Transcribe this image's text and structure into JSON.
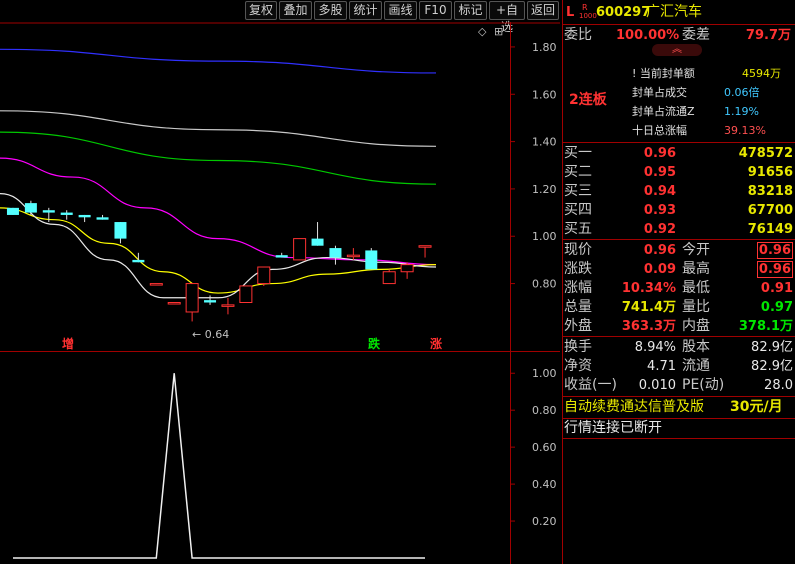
{
  "toolbar": {
    "buttons": [
      "复权",
      "叠加",
      "多股",
      "统计",
      "画线",
      "F10",
      "标记",
      "+自选",
      "返回"
    ]
  },
  "header": {
    "market_flag": "L",
    "badge_top": "R",
    "badge_bottom": "1000",
    "code": "600297",
    "name": "广汇汽车"
  },
  "ratio": {
    "wb_label": "委比",
    "wb_value": "100.00%",
    "wc_label": "委差",
    "wc_value": "79.7万"
  },
  "limit_up": {
    "badge": "2连板",
    "lines": [
      {
        "label": "当前封单额",
        "value": "4594万",
        "color": "#e8e800"
      },
      {
        "label": "封单占成交",
        "value": "0.06倍",
        "color": "#40c8ff"
      },
      {
        "label": "封单占流通Z",
        "value": "1.19%",
        "color": "#40c8ff"
      },
      {
        "label": "十日总涨幅",
        "value": "39.13%",
        "color": "#ff5050"
      }
    ]
  },
  "bids": [
    {
      "label": "买一",
      "price": "0.96",
      "volume": "478572"
    },
    {
      "label": "买二",
      "price": "0.95",
      "volume": "91656"
    },
    {
      "label": "买三",
      "price": "0.94",
      "volume": "83218"
    },
    {
      "label": "买四",
      "price": "0.93",
      "volume": "67700"
    },
    {
      "label": "买五",
      "price": "0.92",
      "volume": "76149"
    }
  ],
  "quote": [
    {
      "l1": "现价",
      "v1": "0.96",
      "c1": "red",
      "l2": "今开",
      "v2": "0.96",
      "c2": "red",
      "box2": true
    },
    {
      "l1": "涨跌",
      "v1": "0.09",
      "c1": "red",
      "l2": "最高",
      "v2": "0.96",
      "c2": "red",
      "box2": true
    },
    {
      "l1": "涨幅",
      "v1": "10.34%",
      "c1": "red",
      "l2": "最低",
      "v2": "0.91",
      "c2": "red",
      "box2": false
    },
    {
      "l1": "总量",
      "v1": "741.4万",
      "c1": "yel",
      "l2": "量比",
      "v2": "0.97",
      "c2": "grn",
      "box2": false
    },
    {
      "l1": "外盘",
      "v1": "363.3万",
      "c1": "red",
      "l2": "内盘",
      "v2": "378.1万",
      "c2": "grn",
      "box2": false
    }
  ],
  "fundamentals": [
    {
      "l1": "换手",
      "v1": "8.94%",
      "l2": "股本",
      "v2": "82.9亿"
    },
    {
      "l1": "净资",
      "v1": "4.71",
      "l2": "流通",
      "v2": "82.9亿"
    },
    {
      "l1": "收益(一)",
      "v1": "0.010",
      "l2": "PE(动)",
      "v2": "28.0"
    }
  ],
  "promo": {
    "text": "自动续费通达信普及版",
    "price": "30元/月"
  },
  "status": "行情连接已断开",
  "chart_data": {
    "type": "candlestick",
    "y_ticks": [
      "1.80",
      "1.60",
      "1.40",
      "1.20",
      "1.00",
      "0.80"
    ],
    "ylim": [
      0.57,
      1.88
    ],
    "annotation_low": "0.64",
    "markers": [
      {
        "text": "增",
        "color": "#ff3030"
      },
      {
        "text": "跌",
        "color": "#00e600"
      },
      {
        "text": "涨",
        "color": "#ff3030"
      }
    ],
    "candles": [
      {
        "open": 1.12,
        "close": 1.09,
        "high": 1.12,
        "low": 1.09
      },
      {
        "open": 1.14,
        "close": 1.1,
        "high": 1.15,
        "low": 1.09
      },
      {
        "open": 1.11,
        "close": 1.1,
        "high": 1.12,
        "low": 1.06
      },
      {
        "open": 1.1,
        "close": 1.09,
        "high": 1.11,
        "low": 1.07
      },
      {
        "open": 1.09,
        "close": 1.08,
        "high": 1.09,
        "low": 1.06
      },
      {
        "open": 1.08,
        "close": 1.07,
        "high": 1.09,
        "low": 1.07
      },
      {
        "open": 1.06,
        "close": 0.99,
        "high": 1.06,
        "low": 0.97
      },
      {
        "open": 0.9,
        "close": 0.89,
        "high": 0.93,
        "low": 0.89
      },
      {
        "open": 0.8,
        "close": 0.8,
        "high": 0.8,
        "low": 0.8
      },
      {
        "open": 0.72,
        "close": 0.72,
        "high": 0.72,
        "low": 0.72
      },
      {
        "open": 0.68,
        "close": 0.8,
        "high": 0.8,
        "low": 0.64
      },
      {
        "open": 0.73,
        "close": 0.72,
        "high": 0.75,
        "low": 0.71
      },
      {
        "open": 0.71,
        "close": 0.71,
        "high": 0.74,
        "low": 0.67
      },
      {
        "open": 0.72,
        "close": 0.79,
        "high": 0.79,
        "low": 0.72
      },
      {
        "open": 0.8,
        "close": 0.87,
        "high": 0.87,
        "low": 0.79
      },
      {
        "open": 0.92,
        "close": 0.91,
        "high": 0.93,
        "low": 0.91
      },
      {
        "open": 0.9,
        "close": 0.99,
        "high": 0.99,
        "low": 0.9
      },
      {
        "open": 0.99,
        "close": 0.96,
        "high": 1.06,
        "low": 0.96
      },
      {
        "open": 0.95,
        "close": 0.91,
        "high": 0.96,
        "low": 0.88
      },
      {
        "open": 0.92,
        "close": 0.92,
        "high": 0.95,
        "low": 0.9
      },
      {
        "open": 0.94,
        "close": 0.86,
        "high": 0.95,
        "low": 0.86
      },
      {
        "open": 0.8,
        "close": 0.85,
        "high": 0.86,
        "low": 0.8
      },
      {
        "open": 0.85,
        "close": 0.88,
        "high": 0.89,
        "low": 0.82
      },
      {
        "open": 0.96,
        "close": 0.96,
        "high": 0.96,
        "low": 0.91
      }
    ],
    "ma_lines": [
      {
        "color": "#3030ff",
        "points": [
          1.79,
          1.74,
          1.69
        ]
      },
      {
        "color": "#c8c8c8",
        "points": [
          1.53,
          1.45,
          1.38
        ]
      },
      {
        "color": "#00c800",
        "points": [
          1.44,
          1.32,
          1.22
        ]
      },
      {
        "color": "#ff00ff",
        "points": [
          1.33,
          1.25,
          1.12,
          0.99,
          0.91,
          0.9,
          0.88
        ]
      },
      {
        "color": "#ffff00",
        "points": [
          1.12,
          1.07,
          0.97,
          0.85,
          0.76,
          0.8,
          0.84,
          0.86,
          0.88
        ]
      },
      {
        "color": "#e8e8e8",
        "points": [
          1.18,
          1.05,
          0.9,
          0.74,
          0.74,
          0.86,
          0.91,
          0.89,
          0.87
        ]
      }
    ],
    "sub": {
      "type": "line",
      "y_ticks": [
        "1.00",
        "0.80",
        "0.60",
        "0.40",
        "0.20"
      ],
      "ylim": [
        0,
        1.05
      ],
      "values": [
        0,
        0,
        0,
        0,
        0,
        0,
        0,
        0,
        0,
        1,
        0,
        0,
        0,
        0,
        0,
        0,
        0,
        0,
        0,
        0,
        0,
        0,
        0,
        0
      ]
    }
  }
}
